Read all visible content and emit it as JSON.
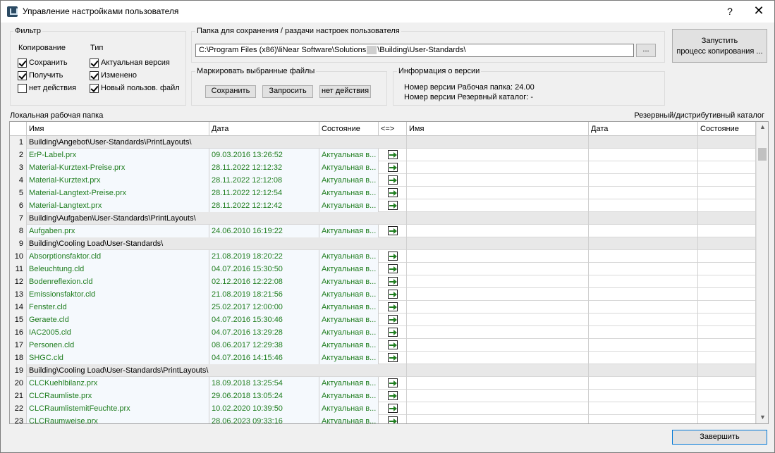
{
  "window": {
    "title": "Управление настройками пользователя",
    "help": "?",
    "close": "✕"
  },
  "filter": {
    "legend": "Фильтр",
    "copy_heading": "Копирование",
    "type_heading": "Тип",
    "copy_options": [
      {
        "label": "Сохранить",
        "checked": true
      },
      {
        "label": "Получить",
        "checked": true
      },
      {
        "label": "нет действия",
        "checked": false
      }
    ],
    "type_options": [
      {
        "label": "Актуальная версия",
        "checked": true
      },
      {
        "label": "Изменено",
        "checked": true
      },
      {
        "label": "Новый пользов. файл",
        "checked": true
      }
    ]
  },
  "folder": {
    "legend": "Папка для сохранения / раздачи настроек пользователя",
    "path_part1": "C:\\Program Files (x86)\\liNear Software\\Solutions",
    "path_part2": "\\Building\\User-Standards\\",
    "browse": "..."
  },
  "mark": {
    "legend": "Маркировать выбранные файлы",
    "save": "Сохранить",
    "request": "Запросить",
    "none": "нет действия"
  },
  "version": {
    "legend": "Информация о версии",
    "line1": "Номер версии Рабочая папка: 24.00",
    "line2": "Номер версии Резервный каталог: -"
  },
  "start_button": {
    "line1": "Запустить",
    "line2": "процесс копирования ..."
  },
  "local_label": "Локальная рабочая папка",
  "backup_label": "Резервный/дистрибутивный каталог",
  "columns": {
    "name": "Имя",
    "date": "Дата",
    "state": "Состояние",
    "arrow": "<=>",
    "name2": "Имя",
    "date2": "Дата",
    "state2": "Состояние"
  },
  "rows": [
    {
      "n": "1",
      "folder": true,
      "name": "Building\\Angebot\\User-Standards\\PrintLayouts\\"
    },
    {
      "n": "2",
      "name": "ErP-Label.prx",
      "date": "09.03.2016 13:26:52",
      "state": "Актуальная в..."
    },
    {
      "n": "3",
      "name": "Material-Kurztext-Preise.prx",
      "date": "28.11.2022 12:12:32",
      "state": "Актуальная в..."
    },
    {
      "n": "4",
      "name": "Material-Kurztext.prx",
      "date": "28.11.2022 12:12:08",
      "state": "Актуальная в..."
    },
    {
      "n": "5",
      "name": "Material-Langtext-Preise.prx",
      "date": "28.11.2022 12:12:54",
      "state": "Актуальная в..."
    },
    {
      "n": "6",
      "name": "Material-Langtext.prx",
      "date": "28.11.2022 12:12:42",
      "state": "Актуальная в..."
    },
    {
      "n": "7",
      "folder": true,
      "name": "Building\\Aufgaben\\User-Standards\\PrintLayouts\\"
    },
    {
      "n": "8",
      "name": "Aufgaben.prx",
      "date": "24.06.2010 16:19:22",
      "state": "Актуальная в..."
    },
    {
      "n": "9",
      "folder": true,
      "name": "Building\\Cooling Load\\User-Standards\\"
    },
    {
      "n": "10",
      "name": "Absorptionsfaktor.cld",
      "date": "21.08.2019 18:20:22",
      "state": "Актуальная в..."
    },
    {
      "n": "11",
      "name": "Beleuchtung.cld",
      "date": "04.07.2016 15:30:50",
      "state": "Актуальная в..."
    },
    {
      "n": "12",
      "name": "Bodenreflexion.cld",
      "date": "02.12.2016 12:22:08",
      "state": "Актуальная в..."
    },
    {
      "n": "13",
      "name": "Emissionsfaktor.cld",
      "date": "21.08.2019 18:21:56",
      "state": "Актуальная в..."
    },
    {
      "n": "14",
      "name": "Fenster.cld",
      "date": "25.02.2017 12:00:00",
      "state": "Актуальная в..."
    },
    {
      "n": "15",
      "name": "Geraete.cld",
      "date": "04.07.2016 15:30:46",
      "state": "Актуальная в..."
    },
    {
      "n": "16",
      "name": "IAC2005.cld",
      "date": "04.07.2016 13:29:28",
      "state": "Актуальная в..."
    },
    {
      "n": "17",
      "name": "Personen.cld",
      "date": "08.06.2017 12:29:38",
      "state": "Актуальная в..."
    },
    {
      "n": "18",
      "name": "SHGC.cld",
      "date": "04.07.2016 14:15:46",
      "state": "Актуальная в..."
    },
    {
      "n": "19",
      "folder": true,
      "name": "Building\\Cooling Load\\User-Standards\\PrintLayouts\\"
    },
    {
      "n": "20",
      "name": "CLCKuehlbilanz.prx",
      "date": "18.09.2018 13:25:54",
      "state": "Актуальная в..."
    },
    {
      "n": "21",
      "name": "CLCRaumliste.prx",
      "date": "29.06.2018 13:05:24",
      "state": "Актуальная в..."
    },
    {
      "n": "22",
      "name": "CLCRaumlistemitFeuchte.prx",
      "date": "10.02.2020 10:39:50",
      "state": "Актуальная в..."
    },
    {
      "n": "23",
      "name": "CLCRaumweise.prx",
      "date": "28.06.2023 09:33:16",
      "state": "Актуальная в..."
    }
  ],
  "finish_button": "Завершить"
}
